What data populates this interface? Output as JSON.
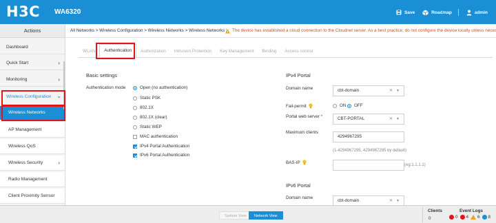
{
  "topbar": {
    "logo": "H3C",
    "model": "WA6320",
    "save": "Save",
    "roadmap": "Roadmap",
    "user": "admin"
  },
  "sidebar": {
    "header": "Actions",
    "items": [
      {
        "label": "Dashboard"
      },
      {
        "label": "Quick Start"
      },
      {
        "label": "Monitoring"
      },
      {
        "label": "Wireless Configuration"
      },
      {
        "label": "Wireless Networks"
      },
      {
        "label": "AP Management"
      },
      {
        "label": "Wireless QoS"
      },
      {
        "label": "Wireless Security"
      },
      {
        "label": "Radio Management"
      },
      {
        "label": "Client Proximity Sensor"
      }
    ]
  },
  "breadcrumb": "All Networks > Wireless Configuration > Wireless Networks > Wireless Networks >",
  "warning": "The device has established a cloud connection to the Cloudnet server. As a best practice, do not configure the device locally unless necessary.",
  "tabs": [
    "WLAN",
    "Authentication",
    "Authorization",
    "Intrusion Protection",
    "Key Management",
    "Binding",
    "Access control"
  ],
  "basic": {
    "title": "Basic settings",
    "mode_label": "Authentication mode",
    "radios": [
      "Open (no authentication)",
      "Static PSK",
      "802.1X",
      "802.1X (clear)",
      "Static WEP"
    ],
    "checks": [
      "MAC authentication",
      "IPv4 Portal Authentication",
      "IPv6 Portal Authentication"
    ]
  },
  "ipv4": {
    "title": "IPv4 Portal",
    "domain_label": "Domain name",
    "domain_value": "cbt-domain",
    "failpermit_label": "Fail-permit",
    "on": "ON",
    "off": "OFF",
    "webserver_label": "Portal web server",
    "webserver_value": "CBT-PORTAL",
    "maxclients_label": "Maximum clients",
    "maxclients_value": "4294967295",
    "maxclients_hint": "(1-4294967295, 4294967295 by default)",
    "basip_label": "BAS-IP",
    "basip_hint": "(eg:1.1.1.1)"
  },
  "ipv6": {
    "title": "IPv6 Portal",
    "domain_label": "Domain name",
    "domain_value": "cbt-domain"
  },
  "footer": {
    "system_view": "System View",
    "network_view": "Network View",
    "clients_label": "Clients",
    "clients_count": "0",
    "eventlogs_label": "Event Logs",
    "ev_red": "0",
    "ev_red2": "4",
    "ev_orange": "6",
    "ev_blue": "8"
  },
  "colors": {
    "brand": "#1a8fd6",
    "highlight": "#e3131c"
  }
}
